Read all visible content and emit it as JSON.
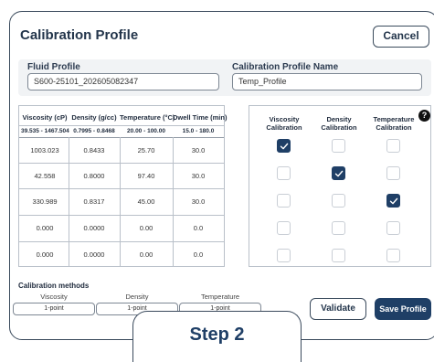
{
  "header": {
    "title": "Calibration Profile",
    "cancel_label": "Cancel"
  },
  "fluid_profile": {
    "label": "Fluid Profile",
    "value": "S600-25101_202605082347"
  },
  "profile_name": {
    "label": "Calibration Profile Name",
    "value": "Temp_Profile"
  },
  "table": {
    "columns": [
      "Viscosity (cP)",
      "Density (g/cc)",
      "Temperature (°C)",
      "Dwell Time (min)"
    ],
    "ranges": [
      "39.535 - 1467.504",
      "0.7995 - 0.8468",
      "20.00 - 100.00",
      "15.0 - 180.0"
    ],
    "rows": [
      [
        "1003.023",
        "0.8433",
        "25.70",
        "30.0"
      ],
      [
        "42.558",
        "0.8000",
        "97.40",
        "30.0"
      ],
      [
        "330.989",
        "0.8317",
        "45.00",
        "30.0"
      ],
      [
        "0.000",
        "0.0000",
        "0.00",
        "0.0"
      ],
      [
        "0.000",
        "0.0000",
        "0.00",
        "0.0"
      ]
    ]
  },
  "calibration": {
    "headers": [
      "Viscosity Calibration",
      "Density Calibration",
      "Temperature Calibration"
    ],
    "checks": [
      [
        true,
        false,
        false
      ],
      [
        false,
        true,
        false
      ],
      [
        false,
        false,
        true
      ],
      [
        false,
        false,
        false
      ],
      [
        false,
        false,
        false
      ]
    ]
  },
  "help_label": "?",
  "methods": {
    "title": "Calibration methods",
    "labels": [
      "Viscosity",
      "Density",
      "Temperature"
    ],
    "values": [
      "1-point",
      "1-point",
      "1-point"
    ]
  },
  "validate_label": "Validate",
  "save_label": "Save Profile",
  "step_label": "Step 2",
  "colors": {
    "accent": "#1f3f66",
    "border": "#3a4a5c",
    "panel": "#f1f3f5"
  }
}
